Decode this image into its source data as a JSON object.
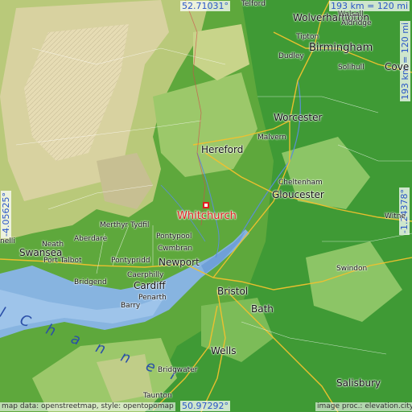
{
  "coords": {
    "north": "52.71031°",
    "south": "50.97292°",
    "west": "-4.05625°",
    "east": "-1.24378°"
  },
  "scale": {
    "horizontal": "193 km = 120 mi",
    "vertical": "193 km = 120 mi"
  },
  "attribution": {
    "left": "map data: openstreetmap, style: opentopomap",
    "right": "image proc.: elevation.city"
  },
  "highlight": {
    "name": "Whitchurch"
  },
  "sea_label": "l   C h a n n e l",
  "places": {
    "telford": "Telford",
    "wolverhampton": "Wolverhampton",
    "walsall": "Walsall",
    "aldridge": "Aldridge",
    "tipton": "Tipton",
    "birmingham": "Birmingham",
    "dudley": "Dudley",
    "solihull": "Solihull",
    "coventry": "Cove",
    "worcester": "Worcester",
    "malvern": "Malvern",
    "hereford": "Hereford",
    "cheltenham": "Cheltenham",
    "gloucester": "Gloucester",
    "witney": "Witne",
    "merthyr": "Merthyr Tydfil",
    "pontypool": "Pontypool",
    "cwmbran": "Cwmbran",
    "newport": "Newport",
    "pontypridd": "Pontypridd",
    "caerphilly": "Caerphilly",
    "cardiff": "Cardiff",
    "penarth": "Penarth",
    "barry": "Barry",
    "bridgend": "Bridgend",
    "neath": "Neath",
    "swansea": "Swansea",
    "porttalbot": "Port Talbot",
    "aberdare": "Aberdare",
    "llanelli": "nelli",
    "swindon": "Swindon",
    "bristol": "Bristol",
    "bath": "Bath",
    "wells": "Wells",
    "bridgwater": "Bridgwater",
    "taunton": "Taunton",
    "salisbury": "Salisbury"
  }
}
